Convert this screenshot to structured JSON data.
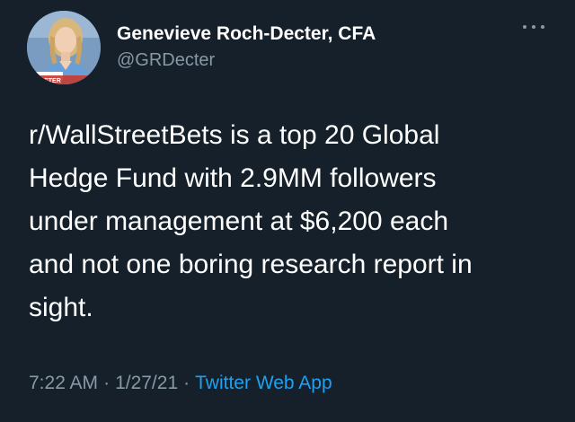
{
  "author": {
    "display_name": "Genevieve Roch-Decter, CFA",
    "handle": "@GRDecter",
    "avatar_badge": "DECTER"
  },
  "tweet": {
    "lines": [
      "r/WallStreetBets is a top 20 Global",
      "Hedge Fund with 2.9MM followers",
      "under management at $6,200 each",
      "and not one boring research report in",
      "sight."
    ],
    "time": "7:22 AM",
    "date": "1/27/21",
    "separator": "·",
    "source": "Twitter Web App"
  },
  "icons": {
    "more": "more-horizontal-icon"
  },
  "colors": {
    "background": "#15202b",
    "text": "#ffffff",
    "secondary": "#8899a6",
    "link": "#1da1f2"
  }
}
